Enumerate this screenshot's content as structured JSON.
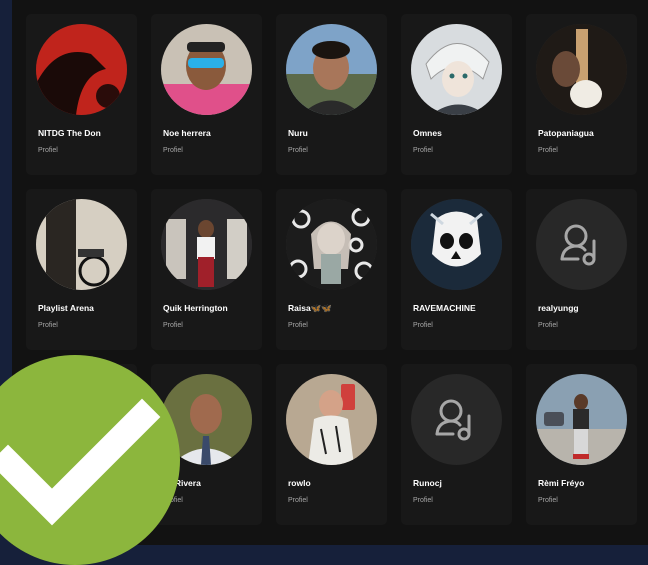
{
  "profiles": [
    {
      "name": "NITDG The Don",
      "subtitle": "Profiel",
      "avatar": "photo-red-silhouette"
    },
    {
      "name": "Noe herrera",
      "subtitle": "Profiel",
      "avatar": "photo-man-sunglasses"
    },
    {
      "name": "Nuru",
      "subtitle": "Profiel",
      "avatar": "photo-young-man"
    },
    {
      "name": "Omnes",
      "subtitle": "Profiel",
      "avatar": "anime-character"
    },
    {
      "name": "Patopaniagua",
      "subtitle": "Profiel",
      "avatar": "photo-guitar"
    },
    {
      "name": "Playlist Arena",
      "subtitle": "Profiel",
      "avatar": "photo-room-bike"
    },
    {
      "name": "Quik Herrington",
      "subtitle": "Profiel",
      "avatar": "photo-man-room"
    },
    {
      "name": "Raisa🦋🦋",
      "subtitle": "Profiel",
      "avatar": "photo-doll"
    },
    {
      "name": "RAVEMACHINE",
      "subtitle": "Profiel",
      "avatar": "skull-mask"
    },
    {
      "name": "realyungg",
      "subtitle": "Profiel",
      "avatar": "user-music-icon"
    },
    {
      "name": "",
      "subtitle": "",
      "avatar": "photo-hidden"
    },
    {
      "name": "ck Rivera",
      "subtitle": "Profiel",
      "avatar": "photo-man-tie"
    },
    {
      "name": "rowlo",
      "subtitle": "Profiel",
      "avatar": "photo-selfie"
    },
    {
      "name": "Runocj",
      "subtitle": "Profiel",
      "avatar": "user-music-icon"
    },
    {
      "name": "Rèmi Fréyo",
      "subtitle": "Profiel",
      "avatar": "photo-man-street"
    }
  ],
  "badge": {
    "icon": "checkmark-icon",
    "color": "#8cb63d"
  }
}
